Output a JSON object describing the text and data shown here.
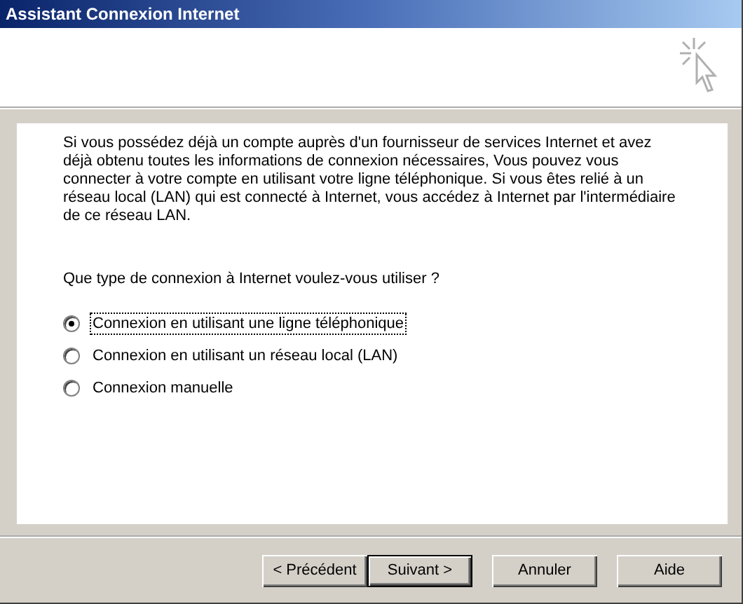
{
  "window": {
    "title": "Assistant Connexion Internet"
  },
  "intro": "Si vous possédez déjà un compte auprès d'un fournisseur de services Internet et avez déjà obtenu toutes les informations de connexion nécessaires, Vous pouvez vous connecter à votre compte en utilisant votre ligne téléphonique. Si vous êtes relié à un réseau local (LAN) qui est connecté à Internet, vous accédez à Internet par l'intermédiaire de ce réseau LAN.",
  "question": "Que type de connexion à Internet voulez-vous utiliser ?",
  "options": [
    {
      "label": "Connexion en utilisant une ligne téléphonique",
      "selected": true
    },
    {
      "label": "Connexion en utilisant un réseau local (LAN)",
      "selected": false
    },
    {
      "label": "Connexion manuelle",
      "selected": false
    }
  ],
  "buttons": [
    {
      "label": "< Précédent",
      "default": false
    },
    {
      "label": "Suivant >",
      "default": true
    },
    {
      "label": "Annuler",
      "default": false
    },
    {
      "label": "Aide",
      "default": false
    }
  ]
}
